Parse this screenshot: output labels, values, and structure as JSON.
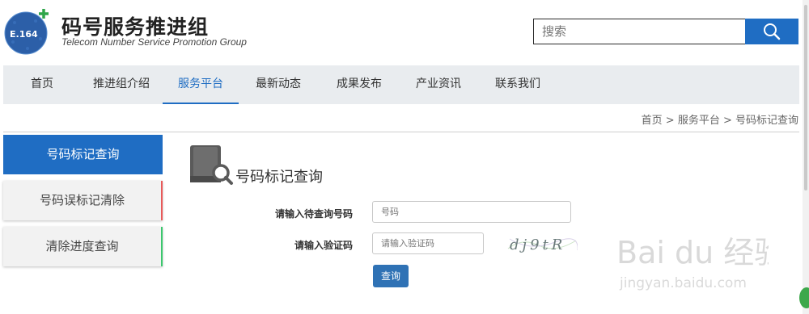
{
  "header": {
    "logo_text": "E.164",
    "title": "码号服务推进组",
    "subtitle": "Telecom Number Service  Promotion Group",
    "search_placeholder": "搜索",
    "search_icon": "search-icon"
  },
  "nav": {
    "items": [
      {
        "label": "首页"
      },
      {
        "label": "推进组介绍"
      },
      {
        "label": "服务平台"
      },
      {
        "label": "最新动态"
      },
      {
        "label": "成果发布"
      },
      {
        "label": "产业资讯"
      },
      {
        "label": "联系我们"
      }
    ],
    "active_index": 2
  },
  "breadcrumb": "首页 > 服务平台 > 号码标记查询",
  "sidebar": {
    "items": [
      {
        "label": "号码标记查询"
      },
      {
        "label": "号码误标记清除"
      },
      {
        "label": "清除进度查询"
      }
    ]
  },
  "main": {
    "title": "号码标记查询",
    "title_icon": "book-search-icon",
    "form": {
      "phone_label": "请输入待查询号码",
      "phone_placeholder": "号码",
      "code_label": "请输入验证码",
      "code_placeholder": "请输入验证码",
      "captcha_text": "dj9tR",
      "submit_label": "查询"
    }
  },
  "watermark": {
    "line1": "Bai du 经验",
    "line2": "jingyan.baidu.com"
  },
  "colors": {
    "primary": "#1f6dc3",
    "nav_bg": "#e9ecef",
    "accent_red": "#e85a5a",
    "accent_green": "#3cc76e"
  }
}
